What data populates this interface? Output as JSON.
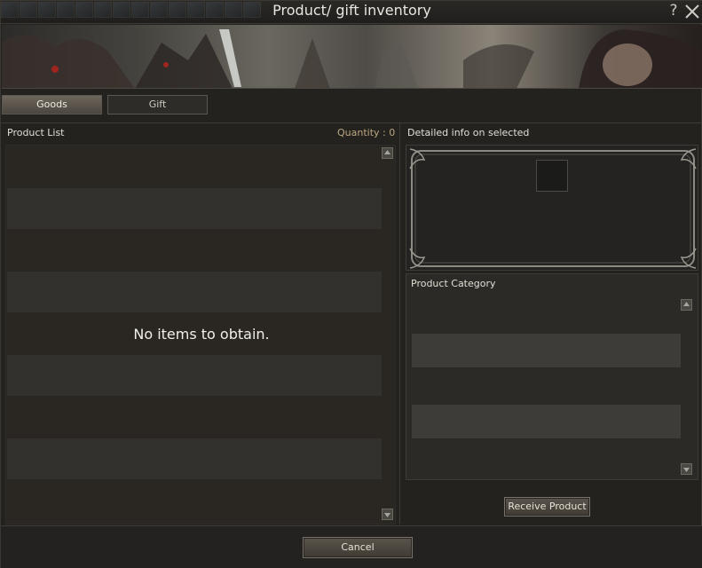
{
  "window": {
    "title": "Product/ gift inventory",
    "help_label": "?"
  },
  "tabs": [
    {
      "label": "Goods",
      "active": true
    },
    {
      "label": "Gift",
      "active": false
    }
  ],
  "product_list": {
    "header": "Product List",
    "quantity_text": "Quantity : 0",
    "empty_message": "No items to obtain."
  },
  "detail": {
    "header": "Detailed info on selected"
  },
  "category": {
    "label": "Product Category"
  },
  "buttons": {
    "receive": "Receive Product",
    "cancel": "Cancel"
  },
  "colors": {
    "accent_quantity": "#bba780",
    "active_tab": "#5c564d"
  }
}
